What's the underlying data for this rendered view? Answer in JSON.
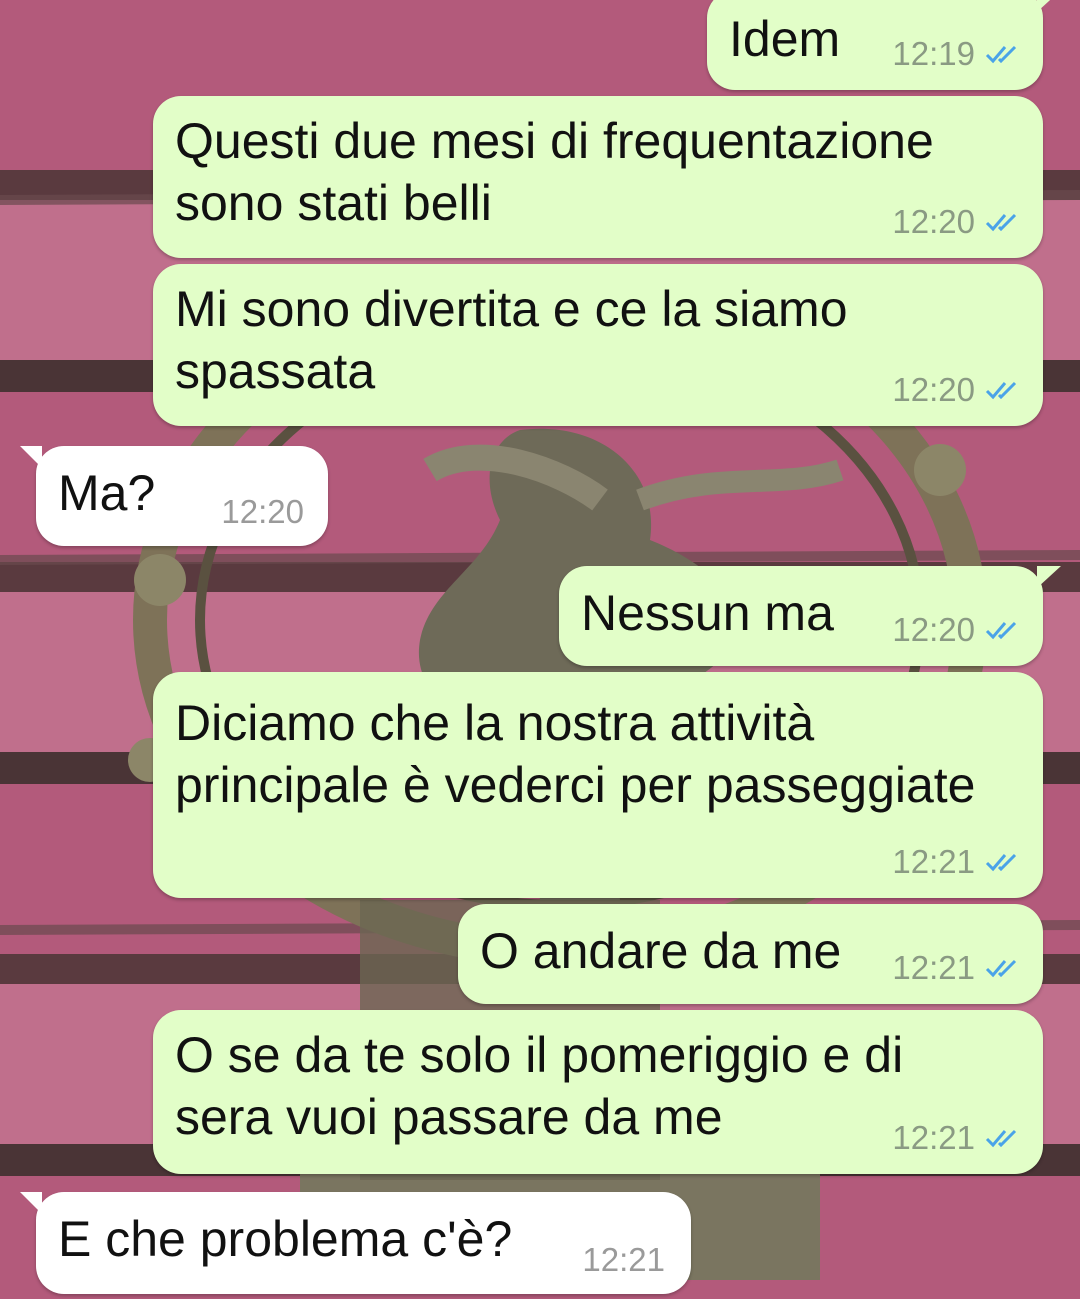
{
  "messages": [
    {
      "direction": "out",
      "text": "Idem",
      "time": "12:19",
      "status": "read",
      "status_icon": "double-check-icon"
    },
    {
      "direction": "out",
      "text": "Questi due mesi di frequentazione\nsono stati belli",
      "time": "12:20",
      "status": "read",
      "status_icon": "double-check-icon"
    },
    {
      "direction": "out",
      "text": "Mi sono divertita e ce la siamo\nspassata",
      "time": "12:20",
      "status": "read",
      "status_icon": "double-check-icon"
    },
    {
      "direction": "in",
      "text": "Ma?",
      "time": "12:20"
    },
    {
      "direction": "out",
      "text": "Nessun ma",
      "time": "12:20",
      "status": "read",
      "status_icon": "double-check-icon"
    },
    {
      "direction": "out",
      "text": "Diciamo che la nostra attività\nprincipale è vederci per passeggiate",
      "time": "12:21",
      "status": "read",
      "status_icon": "double-check-icon"
    },
    {
      "direction": "out",
      "text": "O andare da me",
      "time": "12:21",
      "status": "read",
      "status_icon": "double-check-icon"
    },
    {
      "direction": "out",
      "text": "O se da te solo il pomeriggio e di\nsera vuoi passare da me",
      "time": "12:21",
      "status": "read",
      "status_icon": "double-check-icon"
    },
    {
      "direction": "in",
      "text": "E che problema c'è?",
      "time": "12:21"
    }
  ],
  "colors": {
    "outgoing_bubble": "#e2fec8",
    "incoming_bubble": "#ffffff",
    "read_ticks": "#4aa3e8",
    "wallpaper_pink": "#b35a7b"
  }
}
